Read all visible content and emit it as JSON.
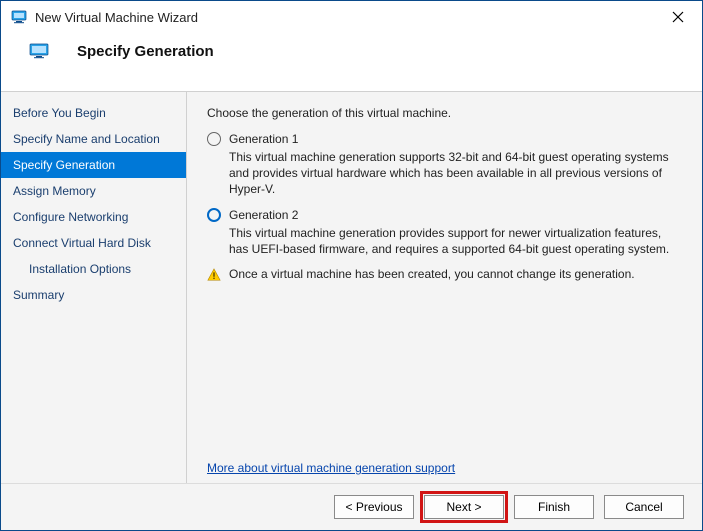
{
  "title_bar": {
    "title": "New Virtual Machine Wizard"
  },
  "header": {
    "title": "Specify Generation"
  },
  "sidebar": {
    "items": [
      {
        "label": "Before You Begin",
        "selected": false,
        "indent": false
      },
      {
        "label": "Specify Name and Location",
        "selected": false,
        "indent": false
      },
      {
        "label": "Specify Generation",
        "selected": true,
        "indent": false
      },
      {
        "label": "Assign Memory",
        "selected": false,
        "indent": false
      },
      {
        "label": "Configure Networking",
        "selected": false,
        "indent": false
      },
      {
        "label": "Connect Virtual Hard Disk",
        "selected": false,
        "indent": false
      },
      {
        "label": "Installation Options",
        "selected": false,
        "indent": true
      },
      {
        "label": "Summary",
        "selected": false,
        "indent": false
      }
    ]
  },
  "content": {
    "prompt": "Choose the generation of this virtual machine.",
    "options": [
      {
        "label": "Generation 1",
        "selected": false,
        "desc": "This virtual machine generation supports 32-bit and 64-bit guest operating systems and provides virtual hardware which has been available in all previous versions of Hyper-V."
      },
      {
        "label": "Generation 2",
        "selected": true,
        "desc": "This virtual machine generation provides support for newer virtualization features, has UEFI-based firmware, and requires a supported 64-bit guest operating system."
      }
    ],
    "warning": "Once a virtual machine has been created, you cannot change its generation.",
    "link": "More about virtual machine generation support"
  },
  "footer": {
    "previous": "< Previous",
    "next": "Next >",
    "finish": "Finish",
    "cancel": "Cancel"
  }
}
